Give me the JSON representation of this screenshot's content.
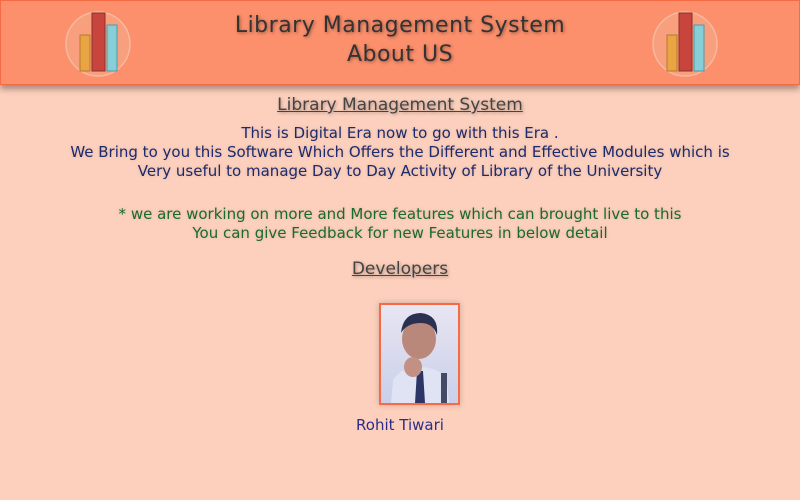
{
  "header": {
    "title": "Library Management System",
    "subtitle": "About US",
    "logo_icon": "books-icon"
  },
  "about": {
    "heading": "Library Management System",
    "lines": [
      "This is Digital Era now to go with this Era .",
      "We Bring to you this Software Which Offers the Different and Effective Modules which is",
      "Very useful to manage Day to Day Activity of Library of the University"
    ],
    "note_lines": [
      "* we are working on more and More features which can brought live to this",
      "You can give Feedback for new Features in below detail"
    ]
  },
  "developers": {
    "heading": "Developers",
    "members": [
      {
        "name": "Rohit Tiwari"
      }
    ]
  },
  "colors": {
    "header": "#fc8f6c",
    "background": "#fdd0bd",
    "border": "#f86a43",
    "text_blue": "#1d2a6b",
    "text_green": "#1a6b2a"
  }
}
